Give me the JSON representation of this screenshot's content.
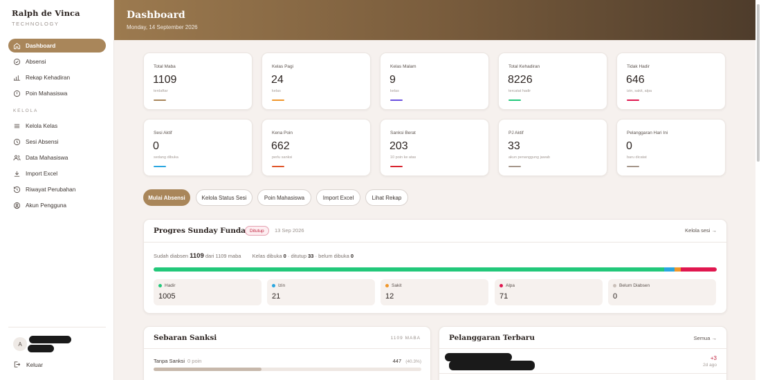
{
  "brand": {
    "name": "Ralph de Vinca",
    "sub": "TECHNOLOGY"
  },
  "nav": {
    "main": [
      {
        "label": "Dashboard",
        "icon": "home-icon",
        "active": true
      },
      {
        "label": "Absensi",
        "icon": "check-circle-icon"
      },
      {
        "label": "Rekap Kehadiran",
        "icon": "bar-chart-icon"
      },
      {
        "label": "Poin Mahasiswa",
        "icon": "alert-circle-icon"
      }
    ],
    "section_label": "KELOLA",
    "manage": [
      {
        "label": "Kelola Kelas",
        "icon": "menu-icon"
      },
      {
        "label": "Sesi Absensi",
        "icon": "clock-icon"
      },
      {
        "label": "Data Mahasiswa",
        "icon": "users-icon"
      },
      {
        "label": "Import Excel",
        "icon": "download-icon"
      },
      {
        "label": "Riwayat Perubahan",
        "icon": "history-icon"
      },
      {
        "label": "Akun Pengguna",
        "icon": "user-circle-icon"
      }
    ]
  },
  "user": {
    "avatar_initial": "A"
  },
  "logout_label": "Keluar",
  "header": {
    "title": "Dashboard",
    "date": "Monday, 14 September 2026"
  },
  "stats": [
    {
      "label": "Total Maba",
      "value": "1109",
      "sub": "terdaftar",
      "color": "#a9865a"
    },
    {
      "label": "Kelas Pagi",
      "value": "24",
      "sub": "kelas",
      "color": "#f0972a"
    },
    {
      "label": "Kelas Malam",
      "value": "9",
      "sub": "kelas",
      "color": "#6a4fe0"
    },
    {
      "label": "Total Kehadiran",
      "value": "8226",
      "sub": "tercatat hadir",
      "color": "#22c87a"
    },
    {
      "label": "Tidak Hadir",
      "value": "646",
      "sub": "izin, sakit, alpa",
      "color": "#e0174f"
    },
    {
      "label": "Sesi Aktif",
      "value": "0",
      "sub": "sedang dibuka",
      "color": "#2aa6e0"
    },
    {
      "label": "Kena Poin",
      "value": "662",
      "sub": "perlu sanksi",
      "color": "#e0552a"
    },
    {
      "label": "Sanksi Berat",
      "value": "203",
      "sub": "10 poin ke atas",
      "color": "#d9242f"
    },
    {
      "label": "PJ Aktif",
      "value": "33",
      "sub": "akun penanggung jawab",
      "color": "#a5968a"
    },
    {
      "label": "Pelanggaran Hari Ini",
      "value": "0",
      "sub": "baru dicatat",
      "color": "#a5968a"
    }
  ],
  "actions": [
    "Mulai Absensi",
    "Kelola Status Sesi",
    "Poin Mahasiswa",
    "Import Excel",
    "Lihat Rekap"
  ],
  "progress": {
    "title": "Progres Sunday Funday",
    "badge": "Ditutup",
    "date": "13 Sep 2026",
    "link": "Kelola sesi →",
    "attended_prefix": "Sudah diabsen",
    "attended": "1109",
    "attended_mid": "dari 1109 maba",
    "kelas_prefix": "Kelas dibuka",
    "kelas_open": "0",
    "kelas_closed_label": "· ditutup",
    "kelas_closed": "33",
    "kelas_unopened_label": "· belum dibuka",
    "kelas_unopened": "0",
    "bar": [
      {
        "name": "Hadir",
        "value": 1005,
        "color": "#22c87a"
      },
      {
        "name": "Izin",
        "value": 21,
        "color": "#2aa6e0"
      },
      {
        "name": "Sakit",
        "value": 12,
        "color": "#f0972a"
      },
      {
        "name": "Alpa",
        "value": 71,
        "color": "#e0174f"
      },
      {
        "name": "Belum Diabsen",
        "value": 0,
        "color": "#c9bfb8"
      }
    ],
    "statuses": [
      {
        "label": "Hadir",
        "value": "1005",
        "color": "#22c87a"
      },
      {
        "label": "Izin",
        "value": "21",
        "color": "#2aa6e0"
      },
      {
        "label": "Sakit",
        "value": "12",
        "color": "#f0972a"
      },
      {
        "label": "Alpa",
        "value": "71",
        "color": "#e0174f"
      },
      {
        "label": "Belum Diabsen",
        "value": "0",
        "color": "#c9bfb8"
      }
    ]
  },
  "sanksi": {
    "title": "Sebaran Sanksi",
    "meta": "1109 MABA",
    "rows": [
      {
        "label": "Tanpa Sanksi",
        "points": "0 poin",
        "count": "447",
        "pct": "(40.3%)",
        "fraction": 0.403
      }
    ]
  },
  "violations": {
    "title": "Pelanggaran Terbaru",
    "link": "Semua →",
    "items": [
      {
        "amount": "+3",
        "time": "2d ago"
      }
    ]
  }
}
